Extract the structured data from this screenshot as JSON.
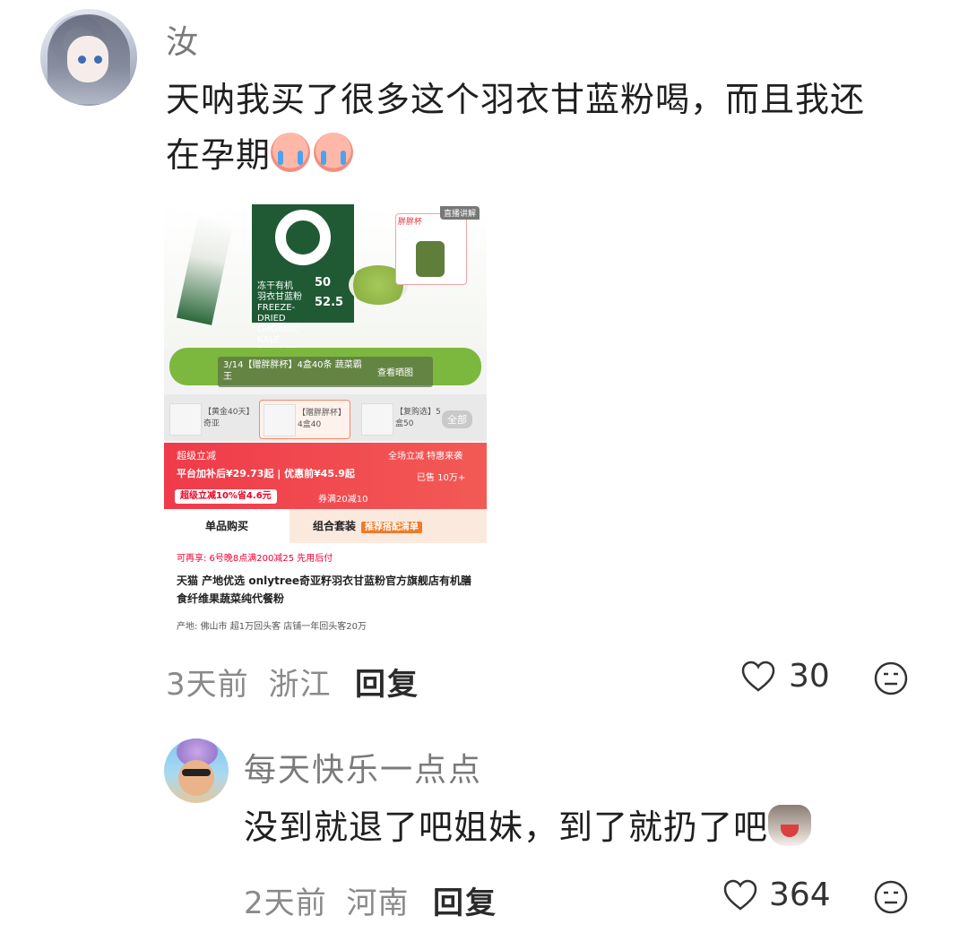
{
  "comment1": {
    "username": "汝",
    "text_line1": "天呐我买了很多这个羽衣甘蓝粉喝，而且我还",
    "text_line2": "在孕期",
    "emoji": "crying-face-emoji",
    "time": "3天前",
    "location": "浙江",
    "reply_label": "回复",
    "likes": "30"
  },
  "screenshot": {
    "box_text": "冻干有机\n羽衣甘蓝粉\nFREEZE-DRIED\nORGANIC\nKALE POWDER",
    "box_num1": "50",
    "box_num2": "52.5",
    "gift_label": "胖胖杯",
    "live_label": "直播讲解",
    "toast_title": "3/14【赠胖胖杯】4盒40条 蔬菜霸王",
    "toast_action": "查看晒图",
    "options": [
      "【黄金40天】奇亚",
      "【赠胖胖杯】4盒40",
      "【复购选】5盒50"
    ],
    "all_label": "全部",
    "promo_label": "超级立减",
    "promo_right": "全场立减 特惠来袭",
    "price_line": "平台加补后¥29.73起 | 优惠前¥45.9起",
    "sold": "已售 10万+",
    "discount_pill": "超级立减10%省4.6元",
    "coupon": "券满20减10",
    "tab_single": "单品购买",
    "tab_combo": "组合套装",
    "tab_combo_tag": "推荐搭配清单",
    "reusable": "可再享: 6号晚8点满200减25  先用后付",
    "title": "天猫 产地优选 onlytree奇亚籽羽衣甘蓝粉官方旗舰店有机膳食纤维果蔬菜纯代餐粉",
    "tags": "产地: 佛山市  超1万回头客  店铺一年回头客20万"
  },
  "comment2": {
    "username": "每天快乐一点点",
    "text": "没到就退了吧姐妹，到了就扔了吧",
    "emoji": "screaming-cat-emoji",
    "time": "2天前",
    "location": "河南",
    "reply_label": "回复",
    "likes": "364"
  },
  "colors": {
    "username": "#7a7a7a",
    "meta": "#8a8a8a",
    "price_red": "#f03a4a",
    "green": "#7cb83e"
  }
}
